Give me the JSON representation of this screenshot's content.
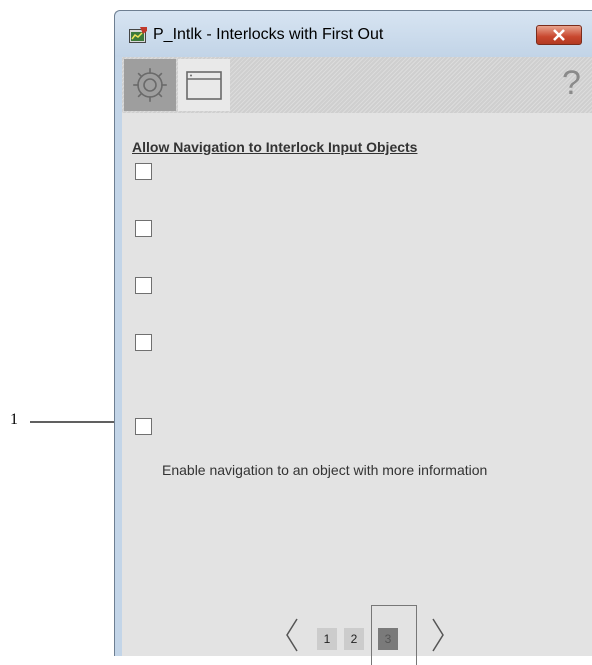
{
  "callout": {
    "number": "1"
  },
  "window": {
    "title": "P_Intlk - Interlocks with First Out",
    "icons": {
      "app": "faceplate-app-icon",
      "close": "close-icon"
    }
  },
  "toolbar": {
    "buttons": [
      {
        "name": "engineering-tab",
        "icon": "gear-icon",
        "active": false
      },
      {
        "name": "window-tab",
        "icon": "window-icon",
        "active": true
      }
    ],
    "help_label": "?"
  },
  "content": {
    "section_title": "Allow Navigation to Interlock Input Objects",
    "checkboxes": [
      {
        "label": "",
        "checked": false
      },
      {
        "label": "",
        "checked": false
      },
      {
        "label": "",
        "checked": false
      },
      {
        "label": "",
        "checked": false
      },
      {
        "label": "Enable navigation to an object with more information",
        "checked": false
      }
    ]
  },
  "pagination": {
    "pages": [
      "1",
      "2",
      "3"
    ],
    "current_page": "3",
    "prev_icon": "chevron-left-icon",
    "next_icon": "chevron-right-icon"
  },
  "colors": {
    "title_bar": "#c8d9ec",
    "client_bg": "#e3e3e3",
    "close_button": "#c8472e",
    "active_page": "#7a7a7a"
  }
}
